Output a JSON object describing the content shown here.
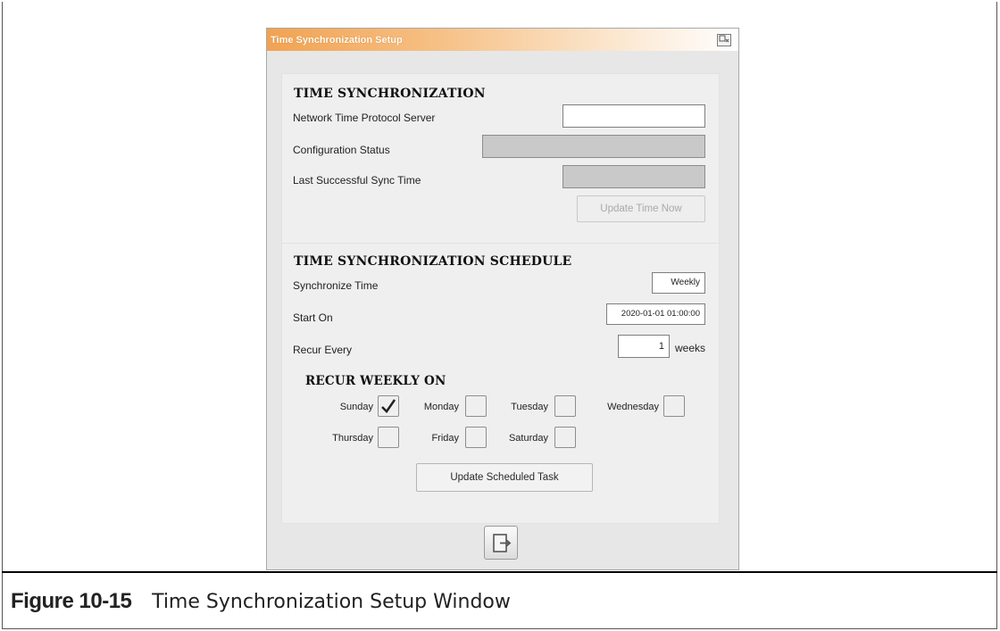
{
  "window": {
    "title": "Time Synchronization Setup",
    "close_icon": "restore-window-icon"
  },
  "time_sync": {
    "heading": "TIME SYNCHRONIZATION",
    "ntp_server_label": "Network Time Protocol Server",
    "ntp_server_value": "",
    "config_status_label": "Configuration Status",
    "config_status_value": "",
    "last_sync_label": "Last Successful Sync Time",
    "last_sync_value": "",
    "update_now_button": "Update Time Now"
  },
  "schedule": {
    "heading": "TIME SYNCHRONIZATION SCHEDULE",
    "sync_time_label": "Synchronize Time",
    "sync_time_value": "Weekly",
    "start_on_label": "Start On",
    "start_on_value": "2020-01-01 01:00:00",
    "recur_every_label": "Recur Every",
    "recur_every_value": "1",
    "recur_every_unit": "weeks",
    "recur_weekly_heading": "RECUR WEEKLY ON",
    "days": {
      "sunday": {
        "label": "Sunday",
        "checked": true
      },
      "monday": {
        "label": "Monday",
        "checked": false
      },
      "tuesday": {
        "label": "Tuesday",
        "checked": false
      },
      "wednesday": {
        "label": "Wednesday",
        "checked": false
      },
      "thursday": {
        "label": "Thursday",
        "checked": false
      },
      "friday": {
        "label": "Friday",
        "checked": false
      },
      "saturday": {
        "label": "Saturday",
        "checked": false
      }
    },
    "check_mark": "✓",
    "update_task_button": "Update Scheduled Task"
  },
  "exit_icon": "exit-door-icon",
  "caption": {
    "number": "Figure 10-15",
    "title": "Time Synchronization Setup Window"
  },
  "colors": {
    "title_gradient_start": "#f1a351",
    "window_bg": "#e7e7e7",
    "disabled_field": "#c9c9c9"
  }
}
